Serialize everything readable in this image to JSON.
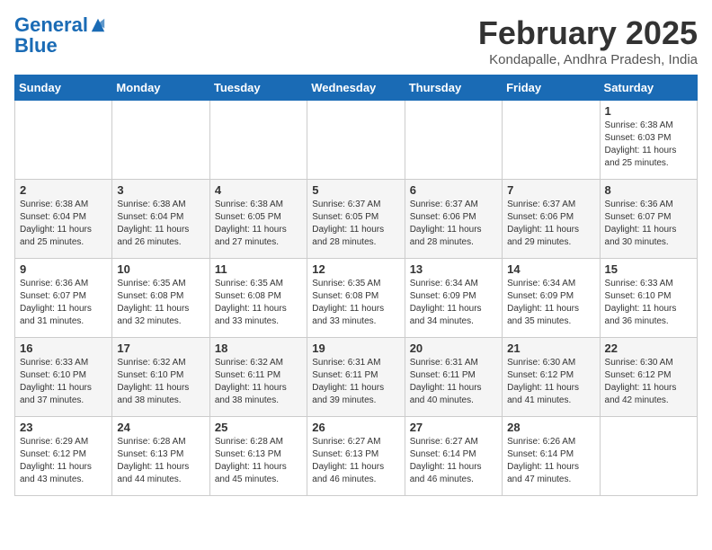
{
  "header": {
    "logo_line1": "General",
    "logo_line2": "Blue",
    "month_title": "February 2025",
    "location": "Kondapalle, Andhra Pradesh, India"
  },
  "days_of_week": [
    "Sunday",
    "Monday",
    "Tuesday",
    "Wednesday",
    "Thursday",
    "Friday",
    "Saturday"
  ],
  "weeks": [
    [
      {
        "day": "",
        "info": ""
      },
      {
        "day": "",
        "info": ""
      },
      {
        "day": "",
        "info": ""
      },
      {
        "day": "",
        "info": ""
      },
      {
        "day": "",
        "info": ""
      },
      {
        "day": "",
        "info": ""
      },
      {
        "day": "1",
        "info": "Sunrise: 6:38 AM\nSunset: 6:03 PM\nDaylight: 11 hours\nand 25 minutes."
      }
    ],
    [
      {
        "day": "2",
        "info": "Sunrise: 6:38 AM\nSunset: 6:04 PM\nDaylight: 11 hours\nand 25 minutes."
      },
      {
        "day": "3",
        "info": "Sunrise: 6:38 AM\nSunset: 6:04 PM\nDaylight: 11 hours\nand 26 minutes."
      },
      {
        "day": "4",
        "info": "Sunrise: 6:38 AM\nSunset: 6:05 PM\nDaylight: 11 hours\nand 27 minutes."
      },
      {
        "day": "5",
        "info": "Sunrise: 6:37 AM\nSunset: 6:05 PM\nDaylight: 11 hours\nand 28 minutes."
      },
      {
        "day": "6",
        "info": "Sunrise: 6:37 AM\nSunset: 6:06 PM\nDaylight: 11 hours\nand 28 minutes."
      },
      {
        "day": "7",
        "info": "Sunrise: 6:37 AM\nSunset: 6:06 PM\nDaylight: 11 hours\nand 29 minutes."
      },
      {
        "day": "8",
        "info": "Sunrise: 6:36 AM\nSunset: 6:07 PM\nDaylight: 11 hours\nand 30 minutes."
      }
    ],
    [
      {
        "day": "9",
        "info": "Sunrise: 6:36 AM\nSunset: 6:07 PM\nDaylight: 11 hours\nand 31 minutes."
      },
      {
        "day": "10",
        "info": "Sunrise: 6:35 AM\nSunset: 6:08 PM\nDaylight: 11 hours\nand 32 minutes."
      },
      {
        "day": "11",
        "info": "Sunrise: 6:35 AM\nSunset: 6:08 PM\nDaylight: 11 hours\nand 33 minutes."
      },
      {
        "day": "12",
        "info": "Sunrise: 6:35 AM\nSunset: 6:08 PM\nDaylight: 11 hours\nand 33 minutes."
      },
      {
        "day": "13",
        "info": "Sunrise: 6:34 AM\nSunset: 6:09 PM\nDaylight: 11 hours\nand 34 minutes."
      },
      {
        "day": "14",
        "info": "Sunrise: 6:34 AM\nSunset: 6:09 PM\nDaylight: 11 hours\nand 35 minutes."
      },
      {
        "day": "15",
        "info": "Sunrise: 6:33 AM\nSunset: 6:10 PM\nDaylight: 11 hours\nand 36 minutes."
      }
    ],
    [
      {
        "day": "16",
        "info": "Sunrise: 6:33 AM\nSunset: 6:10 PM\nDaylight: 11 hours\nand 37 minutes."
      },
      {
        "day": "17",
        "info": "Sunrise: 6:32 AM\nSunset: 6:10 PM\nDaylight: 11 hours\nand 38 minutes."
      },
      {
        "day": "18",
        "info": "Sunrise: 6:32 AM\nSunset: 6:11 PM\nDaylight: 11 hours\nand 38 minutes."
      },
      {
        "day": "19",
        "info": "Sunrise: 6:31 AM\nSunset: 6:11 PM\nDaylight: 11 hours\nand 39 minutes."
      },
      {
        "day": "20",
        "info": "Sunrise: 6:31 AM\nSunset: 6:11 PM\nDaylight: 11 hours\nand 40 minutes."
      },
      {
        "day": "21",
        "info": "Sunrise: 6:30 AM\nSunset: 6:12 PM\nDaylight: 11 hours\nand 41 minutes."
      },
      {
        "day": "22",
        "info": "Sunrise: 6:30 AM\nSunset: 6:12 PM\nDaylight: 11 hours\nand 42 minutes."
      }
    ],
    [
      {
        "day": "23",
        "info": "Sunrise: 6:29 AM\nSunset: 6:12 PM\nDaylight: 11 hours\nand 43 minutes."
      },
      {
        "day": "24",
        "info": "Sunrise: 6:28 AM\nSunset: 6:13 PM\nDaylight: 11 hours\nand 44 minutes."
      },
      {
        "day": "25",
        "info": "Sunrise: 6:28 AM\nSunset: 6:13 PM\nDaylight: 11 hours\nand 45 minutes."
      },
      {
        "day": "26",
        "info": "Sunrise: 6:27 AM\nSunset: 6:13 PM\nDaylight: 11 hours\nand 46 minutes."
      },
      {
        "day": "27",
        "info": "Sunrise: 6:27 AM\nSunset: 6:14 PM\nDaylight: 11 hours\nand 46 minutes."
      },
      {
        "day": "28",
        "info": "Sunrise: 6:26 AM\nSunset: 6:14 PM\nDaylight: 11 hours\nand 47 minutes."
      },
      {
        "day": "",
        "info": ""
      }
    ]
  ]
}
